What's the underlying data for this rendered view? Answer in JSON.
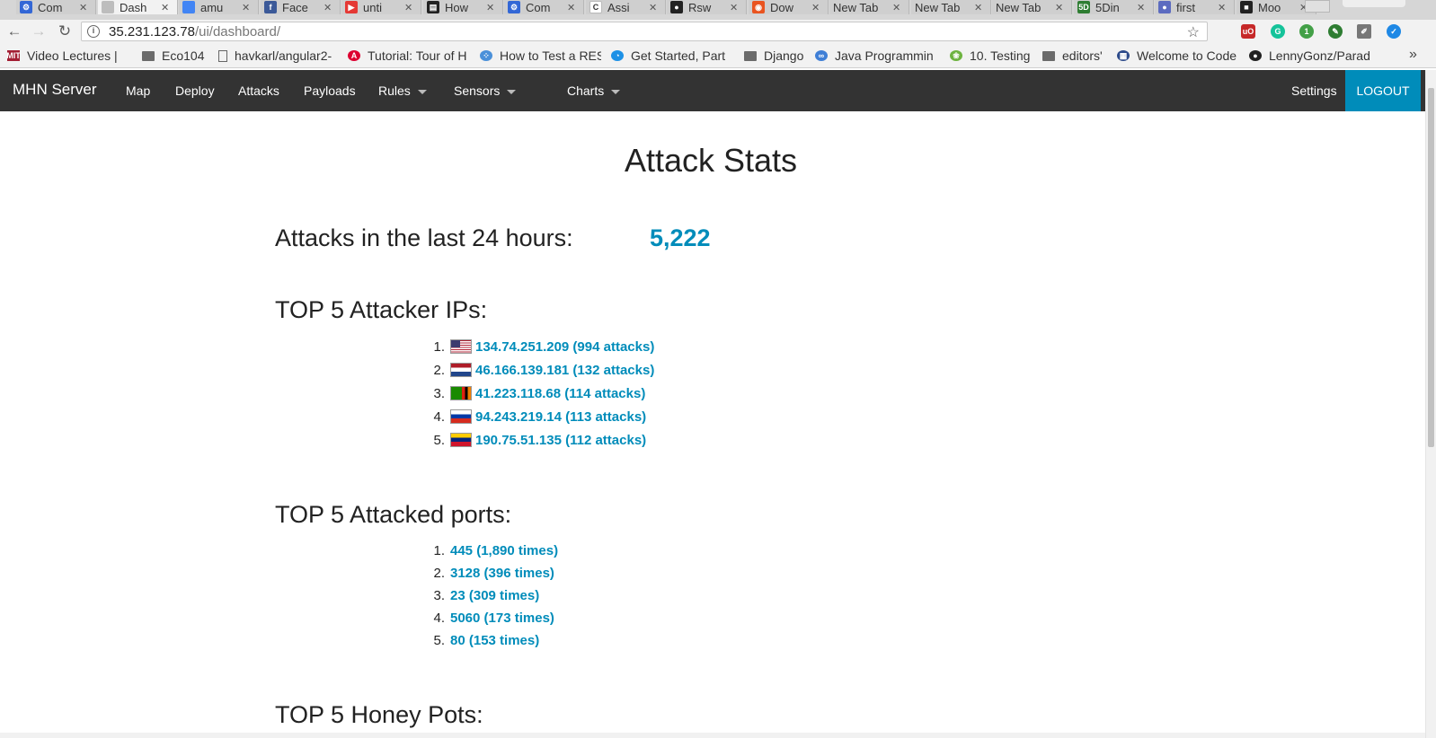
{
  "browser": {
    "tabs": [
      {
        "title": "Com",
        "fav_color": "#3367d6",
        "fav_glyph": "⚙"
      },
      {
        "title": "Dash",
        "fav_color": "#bdbdbd",
        "fav_glyph": "",
        "active": true
      },
      {
        "title": "amu",
        "fav_color": "#4285f4",
        "fav_glyph": ""
      },
      {
        "title": "Face",
        "fav_color": "#3b5998",
        "fav_glyph": "f"
      },
      {
        "title": "unti",
        "fav_color": "#e53935",
        "fav_glyph": "▶"
      },
      {
        "title": "How",
        "fav_color": "#222222",
        "fav_glyph": "▤"
      },
      {
        "title": "Com",
        "fav_color": "#3367d6",
        "fav_glyph": "⚙"
      },
      {
        "title": "Assi",
        "fav_color": "#ffffff",
        "fav_glyph": "C"
      },
      {
        "title": "Rsw",
        "fav_color": "#222222",
        "fav_glyph": "●"
      },
      {
        "title": "Dow",
        "fav_color": "#e95420",
        "fav_glyph": "◉"
      },
      {
        "title": "New Tab",
        "fav_color": "",
        "fav_glyph": ""
      },
      {
        "title": "New Tab",
        "fav_color": "",
        "fav_glyph": ""
      },
      {
        "title": "New Tab",
        "fav_color": "",
        "fav_glyph": ""
      },
      {
        "title": "5Din",
        "fav_color": "#2e7d32",
        "fav_glyph": "5D"
      },
      {
        "title": "first",
        "fav_color": "#5c6bc0",
        "fav_glyph": "●"
      },
      {
        "title": "Moo",
        "fav_color": "#222222",
        "fav_glyph": "■"
      }
    ],
    "close_glyph": "✕",
    "url_host": "35.231.123.78",
    "url_path": "/ui/dashboard/",
    "back_icon": "←",
    "forward_icon": "→",
    "reload_icon": "↻",
    "star_icon": "☆",
    "info_glyph": "i",
    "bookmarks": [
      {
        "label": "Video Lectures | ",
        "icon": "mit",
        "color": "#a31f34",
        "glyph": "MIT"
      },
      {
        "label": "Eco104",
        "icon": "folder"
      },
      {
        "label": "havkarl/angular2-",
        "icon": "page"
      },
      {
        "label": "Tutorial: Tour of H",
        "icon": "angular",
        "color": "#dd0031",
        "glyph": "A"
      },
      {
        "label": "How to Test a RES",
        "icon": "nodes",
        "color": "#4a90d9",
        "glyph": "⁘"
      },
      {
        "label": "Get Started, Part",
        "icon": "docker",
        "color": "#1d91e6",
        "glyph": "◔"
      },
      {
        "label": "Django",
        "icon": "folder"
      },
      {
        "label": "Java Programmin",
        "icon": "infinity",
        "color": "#3f7fd6",
        "glyph": "∞"
      },
      {
        "label": "10. Testing",
        "icon": "spring",
        "color": "#6db33f",
        "glyph": "❀"
      },
      {
        "label": "editors'",
        "icon": "folder"
      },
      {
        "label": "Welcome to Code",
        "icon": "code",
        "color": "#2c4a8a",
        "glyph": "▦"
      },
      {
        "label": "LennyGonz/Parad",
        "icon": "github",
        "color": "#222222",
        "glyph": "●"
      }
    ],
    "more_bookmarks": "»"
  },
  "navbar": {
    "brand": "MHN Server",
    "links": [
      {
        "label": "Map",
        "dropdown": false
      },
      {
        "label": "Deploy",
        "dropdown": false
      },
      {
        "label": "Attacks",
        "dropdown": false
      },
      {
        "label": "Payloads",
        "dropdown": false
      },
      {
        "label": "Rules",
        "dropdown": true
      },
      {
        "label": "Sensors",
        "dropdown": true
      },
      {
        "label": "Charts",
        "dropdown": true
      }
    ],
    "settings": "Settings",
    "logout": "LOGOUT"
  },
  "main": {
    "title": "Attack Stats",
    "attacks_24h_label": "Attacks in the last 24 hours:",
    "attacks_24h_value": "5,222",
    "top_ips_heading": "TOP 5 Attacker IPs:",
    "top_ips": [
      {
        "rank": "1.",
        "flag": "us",
        "text": "134.74.251.209 (994 attacks)"
      },
      {
        "rank": "2.",
        "flag": "nl",
        "text": "46.166.139.181 (132 attacks)"
      },
      {
        "rank": "3.",
        "flag": "zm",
        "text": "41.223.118.68 (114 attacks)"
      },
      {
        "rank": "4.",
        "flag": "ru",
        "text": "94.243.219.14 (113 attacks)"
      },
      {
        "rank": "5.",
        "flag": "ve",
        "text": "190.75.51.135 (112 attacks)"
      }
    ],
    "top_ports_heading": "TOP 5 Attacked ports:",
    "top_ports": [
      {
        "rank": "1.",
        "text": "445 (1,890 times)"
      },
      {
        "rank": "2.",
        "text": "3128 (396 times)"
      },
      {
        "rank": "3.",
        "text": "23 (309 times)"
      },
      {
        "rank": "4.",
        "text": "5060 (173 times)"
      },
      {
        "rank": "5.",
        "text": "80 (153 times)"
      }
    ],
    "top_honeypots_heading": "TOP 5 Honey Pots:"
  },
  "colors": {
    "navbar_bg": "#333333",
    "accent": "#008cba",
    "text": "#222222"
  }
}
